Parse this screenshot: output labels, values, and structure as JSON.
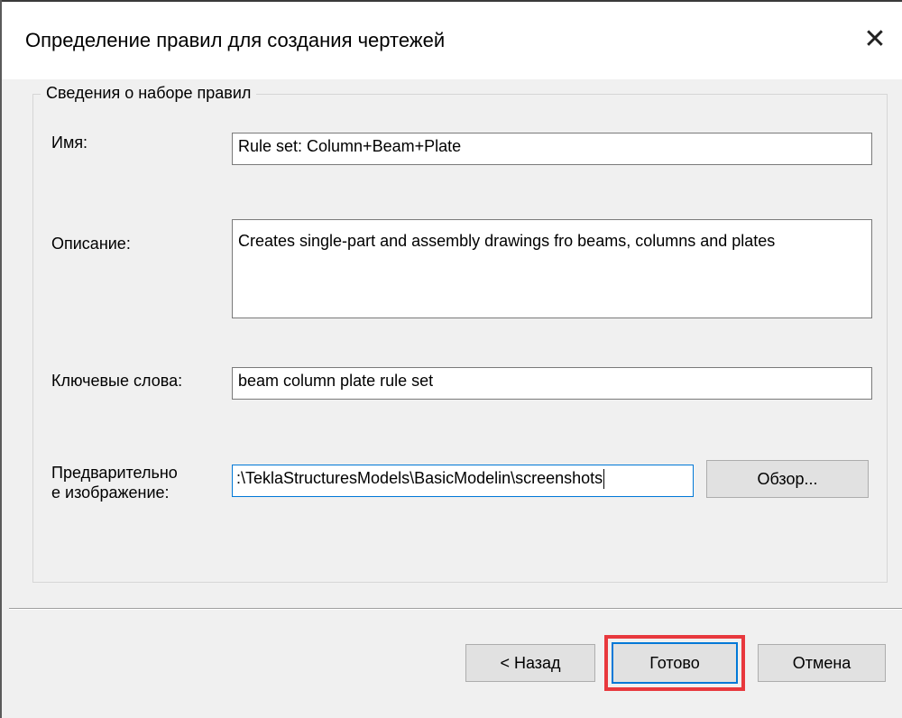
{
  "window": {
    "title": "Определение правил для создания чертежей",
    "close_symbol": "✕"
  },
  "group": {
    "legend": "Сведения о наборе правил"
  },
  "fields": {
    "name_label": "Имя:",
    "name_value": "Rule set: Column+Beam+Plate",
    "description_label": "Описание:",
    "description_value": "Creates single-part and assembly drawings fro beams, columns and plates",
    "keywords_label": "Ключевые слова:",
    "keywords_value": "beam column plate rule set",
    "preview_label_line1": "Предварительно",
    "preview_label_line2": "е изображение:",
    "preview_value": ":\\TeklaStructuresModels\\BasicModelin\\screenshots"
  },
  "buttons": {
    "browse": "Обзор...",
    "back": "< Назад",
    "finish": "Готово",
    "cancel": "Отмена"
  },
  "colors": {
    "highlight": "#e8383d",
    "focus": "#0078d7"
  }
}
